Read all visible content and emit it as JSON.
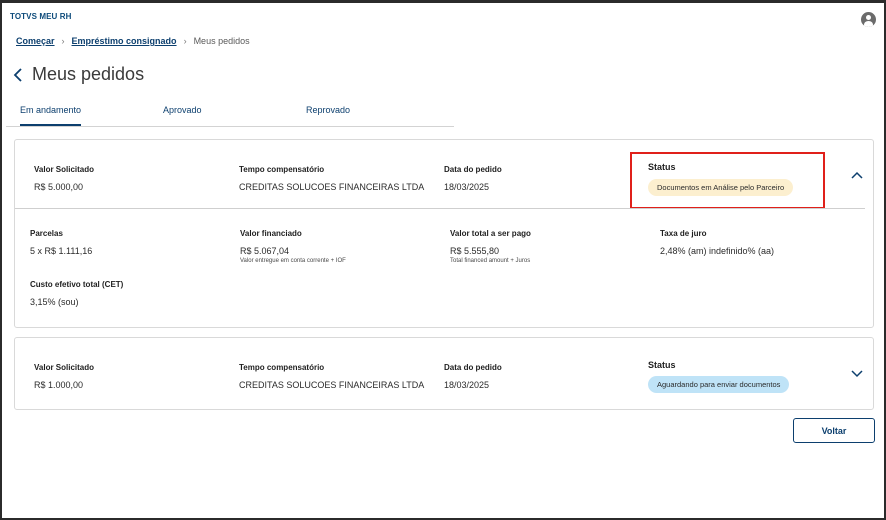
{
  "app": {
    "title": "TOTVS MEU RH"
  },
  "breadcrumb": {
    "items": [
      "Começar",
      "Empréstimo consignado"
    ],
    "current": "Meus pedidos"
  },
  "page": {
    "title": "Meus pedidos"
  },
  "tabs": [
    {
      "label": "Em andamento",
      "active": true
    },
    {
      "label": "Aprovado",
      "active": false
    },
    {
      "label": "Reprovado",
      "active": false
    }
  ],
  "orders": [
    {
      "valor_solicitado_label": "Valor Solicitado",
      "valor_solicitado": "R$ 5.000,00",
      "tempo_label": "Tempo compensatório",
      "tempo": "CREDITAS SOLUCOES FINANCEIRAS LTDA",
      "data_label": "Data do pedido",
      "data": "18/03/2025",
      "status_label": "Status",
      "status": "Documentos em Análise pelo Parceiro",
      "status_color": "#fcefcf",
      "expanded": true,
      "details": {
        "parcelas_label": "Parcelas",
        "parcelas": "5 x R$ 1.111,16",
        "valor_financiado_label": "Valor financiado",
        "valor_financiado": "R$ 5.067,04",
        "valor_financiado_hint": "Valor entregue em conta corrente + IOF",
        "valor_total_label": "Valor total a ser pago",
        "valor_total": "R$ 5.555,80",
        "valor_total_hint": "Total financed amount + Juros",
        "taxa_label": "Taxa de juro",
        "taxa": "2,48% (am) indefinido% (aa)",
        "cet_label": "Custo efetivo total (CET)",
        "cet": "3,15% (sou)"
      }
    },
    {
      "valor_solicitado_label": "Valor Solicitado",
      "valor_solicitado": "R$ 1.000,00",
      "tempo_label": "Tempo compensatório",
      "tempo": "CREDITAS SOLUCOES FINANCEIRAS LTDA",
      "data_label": "Data do pedido",
      "data": "18/03/2025",
      "status_label": "Status",
      "status": "Aguardando para enviar documentos",
      "status_color": "#bfe3f7",
      "expanded": false
    }
  ],
  "actions": {
    "back_label": "Voltar"
  },
  "colors": {
    "primary": "#0c3f6e",
    "highlight": "#e0201a"
  }
}
